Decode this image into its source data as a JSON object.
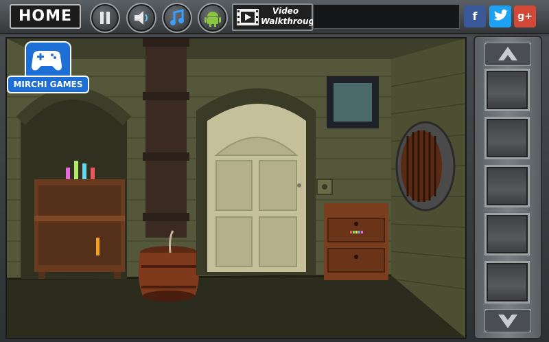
{
  "topbar": {
    "home_label": "HOME",
    "pause_icon": "pause-icon",
    "sound_icon": "speaker-icon",
    "music_icon": "music-note-icon",
    "android_icon": "android-icon",
    "video": {
      "icon": "film-icon",
      "line1": "Video",
      "line2": "Walkthrough"
    },
    "social": [
      {
        "name": "facebook",
        "glyph": "f",
        "color": "#3b5998"
      },
      {
        "name": "twitter",
        "glyph": "t",
        "color": "#1da1f2"
      },
      {
        "name": "google-plus",
        "glyph": "g+",
        "color": "#d34836"
      }
    ]
  },
  "logo": {
    "text": "MIRCHI GAMES",
    "icon": "gamepad-icon"
  },
  "scene": {
    "objects": [
      "left-alcove-shelf",
      "colored-bottles",
      "candle",
      "pipe-column",
      "wooden-barrel",
      "center-door",
      "wall-picture-frame",
      "wall-switch-panel",
      "drawer-cabinet",
      "round-barred-window"
    ]
  },
  "inventory": {
    "up_icon": "arrow-up-icon",
    "down_icon": "arrow-down-icon",
    "slots": 5
  },
  "colors": {
    "wall": "#5d5f3d",
    "wall_dark": "#3f4129",
    "floor": "#2a2b1c",
    "wood": "#7a3e1f",
    "door": "#c7c49c"
  }
}
